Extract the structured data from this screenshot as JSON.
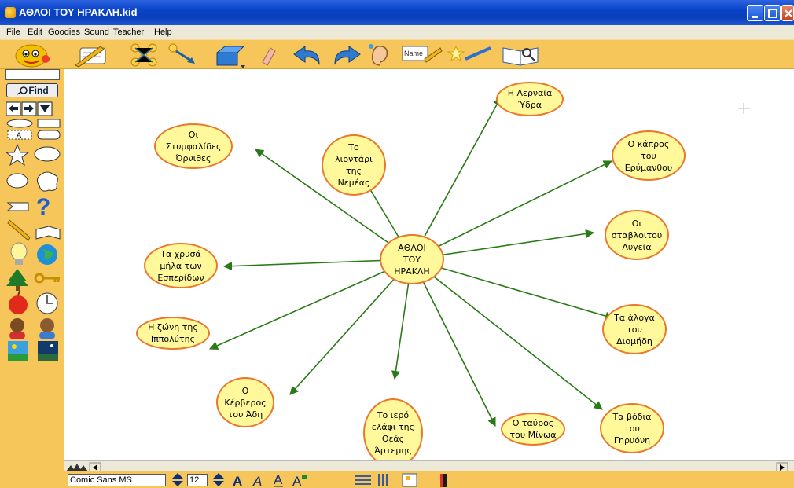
{
  "window": {
    "title": "ΑΘΛΟΙ ΤΟΥ ΗΡΑΚΛΗ.kid"
  },
  "menu": [
    "File",
    "Edit",
    "Goodies",
    "Sound",
    "Teacher",
    "Help"
  ],
  "toolbar": {
    "icons": [
      "mascot-icon",
      "note-pencil-icon",
      "map-icon",
      "arrow-link-icon",
      "magic-box-icon",
      "eraser-icon",
      "undo-icon",
      "redo-icon",
      "ear-icon",
      "name-tag-icon",
      "magic-wand-icon",
      "book-search-icon"
    ]
  },
  "palette": {
    "find_label": "Find"
  },
  "format": {
    "font": "Comic Sans MS",
    "size": "12"
  },
  "map": {
    "center": "ΑΘΛΟΙ\nΤΟΥ\nΗΡΑΚΛΗ",
    "nodes": [
      "Το\nλιοντάρι\nτης\nΝεμέας",
      "Η Λερναία\nΎδρα",
      "Ο κάπρος\nτου\nΕρύμανθου",
      "Οι\nσταβλοιτου\nΑυγεία",
      "Τα άλογα\nτου\nΔιομήδη",
      "Τα βόδια\nτου\nΓηρυόνη",
      "Ο ταύρος\nτου Μίνωα",
      "Το ιερό\nελάφι της\nΘεάς\nΆρτεμης",
      "Ο\nΚέρβερος\nτου Άδη",
      "Η ζώνη της\nΙππολύτης",
      "Τα χρυσά\nμήλα των\nΕσπερίδων",
      "Οι\nΣτυμφαλίδες\nΌρνιθες"
    ]
  },
  "colors": {
    "toolbar": "#f6c65a",
    "node_fill": "#fff99b",
    "node_border": "#e9782c",
    "link": "#2a7a17"
  }
}
